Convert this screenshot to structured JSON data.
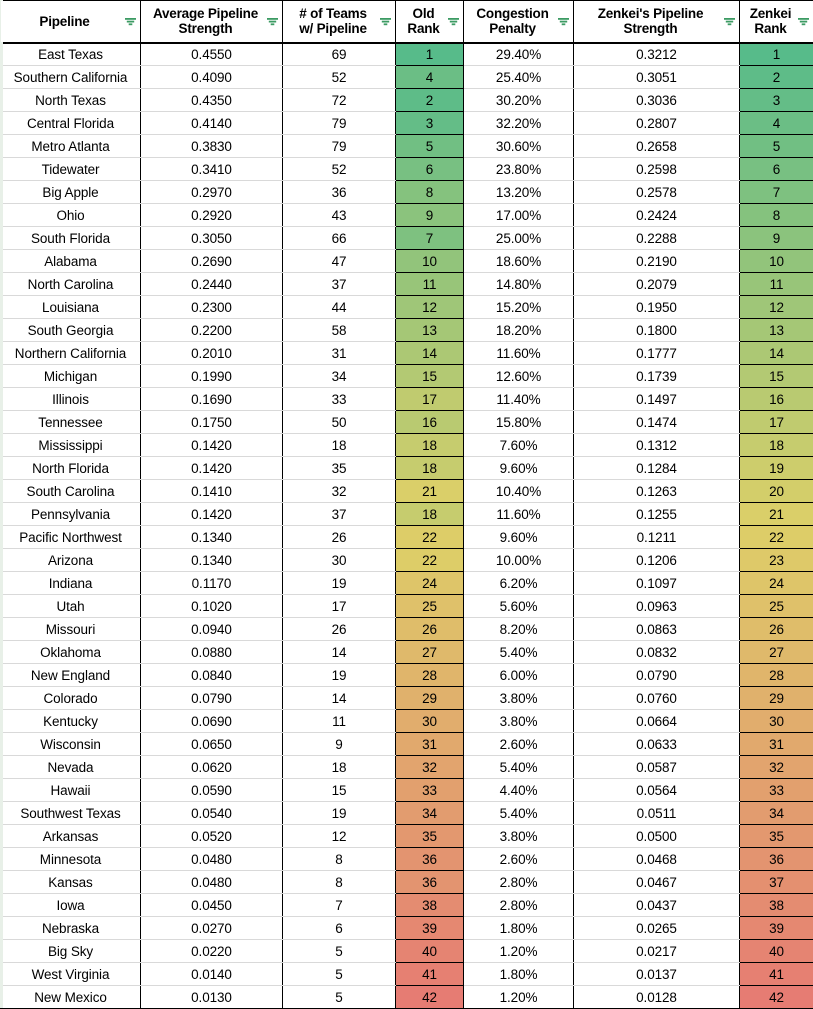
{
  "table": {
    "columns": [
      {
        "key": "pipeline",
        "label": "Pipeline",
        "filter_icon": "filter-icon"
      },
      {
        "key": "avg",
        "label": "Average Pipeline Strength",
        "filter_icon": "filter-icon"
      },
      {
        "key": "teams",
        "label": "# of Teams w/ Pipeline",
        "filter_icon": "filter-icon"
      },
      {
        "key": "old_rank",
        "label": "Old Rank",
        "filter_icon": "filter-icon"
      },
      {
        "key": "congestion",
        "label": "Congestion Penalty",
        "filter_icon": "filter-icon"
      },
      {
        "key": "zenkei_str",
        "label": "Zenkei's Pipeline Strength",
        "filter_icon": "filter-icon"
      },
      {
        "key": "zenkei_rank",
        "label": "Zenkei Rank",
        "filter_icon": "filter-icon"
      }
    ],
    "column_labels_lines": [
      [
        "Pipeline"
      ],
      [
        "Average Pipeline",
        "Strength"
      ],
      [
        "# of Teams",
        "w/ Pipeline"
      ],
      [
        "Old",
        "Rank"
      ],
      [
        "Congestion",
        "Penalty"
      ],
      [
        "Zenkei's Pipeline",
        "Strength"
      ],
      [
        "Zenkei",
        "Rank"
      ]
    ],
    "rows": [
      {
        "pipeline": "East Texas",
        "avg": "0.4550",
        "teams": "69",
        "old_rank": "1",
        "congestion": "29.40%",
        "zenkei_str": "0.3212",
        "zenkei_rank": "1"
      },
      {
        "pipeline": "Southern California",
        "avg": "0.4090",
        "teams": "52",
        "old_rank": "4",
        "congestion": "25.40%",
        "zenkei_str": "0.3051",
        "zenkei_rank": "2"
      },
      {
        "pipeline": "North Texas",
        "avg": "0.4350",
        "teams": "72",
        "old_rank": "2",
        "congestion": "30.20%",
        "zenkei_str": "0.3036",
        "zenkei_rank": "3"
      },
      {
        "pipeline": "Central Florida",
        "avg": "0.4140",
        "teams": "79",
        "old_rank": "3",
        "congestion": "32.20%",
        "zenkei_str": "0.2807",
        "zenkei_rank": "4"
      },
      {
        "pipeline": "Metro Atlanta",
        "avg": "0.3830",
        "teams": "79",
        "old_rank": "5",
        "congestion": "30.60%",
        "zenkei_str": "0.2658",
        "zenkei_rank": "5"
      },
      {
        "pipeline": "Tidewater",
        "avg": "0.3410",
        "teams": "52",
        "old_rank": "6",
        "congestion": "23.80%",
        "zenkei_str": "0.2598",
        "zenkei_rank": "6"
      },
      {
        "pipeline": "Big Apple",
        "avg": "0.2970",
        "teams": "36",
        "old_rank": "8",
        "congestion": "13.20%",
        "zenkei_str": "0.2578",
        "zenkei_rank": "7"
      },
      {
        "pipeline": "Ohio",
        "avg": "0.2920",
        "teams": "43",
        "old_rank": "9",
        "congestion": "17.00%",
        "zenkei_str": "0.2424",
        "zenkei_rank": "8"
      },
      {
        "pipeline": "South Florida",
        "avg": "0.3050",
        "teams": "66",
        "old_rank": "7",
        "congestion": "25.00%",
        "zenkei_str": "0.2288",
        "zenkei_rank": "9"
      },
      {
        "pipeline": "Alabama",
        "avg": "0.2690",
        "teams": "47",
        "old_rank": "10",
        "congestion": "18.60%",
        "zenkei_str": "0.2190",
        "zenkei_rank": "10"
      },
      {
        "pipeline": "North Carolina",
        "avg": "0.2440",
        "teams": "37",
        "old_rank": "11",
        "congestion": "14.80%",
        "zenkei_str": "0.2079",
        "zenkei_rank": "11"
      },
      {
        "pipeline": "Louisiana",
        "avg": "0.2300",
        "teams": "44",
        "old_rank": "12",
        "congestion": "15.20%",
        "zenkei_str": "0.1950",
        "zenkei_rank": "12"
      },
      {
        "pipeline": "South Georgia",
        "avg": "0.2200",
        "teams": "58",
        "old_rank": "13",
        "congestion": "18.20%",
        "zenkei_str": "0.1800",
        "zenkei_rank": "13"
      },
      {
        "pipeline": "Northern California",
        "avg": "0.2010",
        "teams": "31",
        "old_rank": "14",
        "congestion": "11.60%",
        "zenkei_str": "0.1777",
        "zenkei_rank": "14"
      },
      {
        "pipeline": "Michigan",
        "avg": "0.1990",
        "teams": "34",
        "old_rank": "15",
        "congestion": "12.60%",
        "zenkei_str": "0.1739",
        "zenkei_rank": "15"
      },
      {
        "pipeline": "Illinois",
        "avg": "0.1690",
        "teams": "33",
        "old_rank": "17",
        "congestion": "11.40%",
        "zenkei_str": "0.1497",
        "zenkei_rank": "16"
      },
      {
        "pipeline": "Tennessee",
        "avg": "0.1750",
        "teams": "50",
        "old_rank": "16",
        "congestion": "15.80%",
        "zenkei_str": "0.1474",
        "zenkei_rank": "17"
      },
      {
        "pipeline": "Mississippi",
        "avg": "0.1420",
        "teams": "18",
        "old_rank": "18",
        "congestion": "7.60%",
        "zenkei_str": "0.1312",
        "zenkei_rank": "18"
      },
      {
        "pipeline": "North Florida",
        "avg": "0.1420",
        "teams": "35",
        "old_rank": "18",
        "congestion": "9.60%",
        "zenkei_str": "0.1284",
        "zenkei_rank": "19"
      },
      {
        "pipeline": "South Carolina",
        "avg": "0.1410",
        "teams": "32",
        "old_rank": "21",
        "congestion": "10.40%",
        "zenkei_str": "0.1263",
        "zenkei_rank": "20"
      },
      {
        "pipeline": "Pennsylvania",
        "avg": "0.1420",
        "teams": "37",
        "old_rank": "18",
        "congestion": "11.60%",
        "zenkei_str": "0.1255",
        "zenkei_rank": "21"
      },
      {
        "pipeline": "Pacific Northwest",
        "avg": "0.1340",
        "teams": "26",
        "old_rank": "22",
        "congestion": "9.60%",
        "zenkei_str": "0.1211",
        "zenkei_rank": "22"
      },
      {
        "pipeline": "Arizona",
        "avg": "0.1340",
        "teams": "30",
        "old_rank": "22",
        "congestion": "10.00%",
        "zenkei_str": "0.1206",
        "zenkei_rank": "23"
      },
      {
        "pipeline": "Indiana",
        "avg": "0.1170",
        "teams": "19",
        "old_rank": "24",
        "congestion": "6.20%",
        "zenkei_str": "0.1097",
        "zenkei_rank": "24"
      },
      {
        "pipeline": "Utah",
        "avg": "0.1020",
        "teams": "17",
        "old_rank": "25",
        "congestion": "5.60%",
        "zenkei_str": "0.0963",
        "zenkei_rank": "25"
      },
      {
        "pipeline": "Missouri",
        "avg": "0.0940",
        "teams": "26",
        "old_rank": "26",
        "congestion": "8.20%",
        "zenkei_str": "0.0863",
        "zenkei_rank": "26"
      },
      {
        "pipeline": "Oklahoma",
        "avg": "0.0880",
        "teams": "14",
        "old_rank": "27",
        "congestion": "5.40%",
        "zenkei_str": "0.0832",
        "zenkei_rank": "27"
      },
      {
        "pipeline": "New England",
        "avg": "0.0840",
        "teams": "19",
        "old_rank": "28",
        "congestion": "6.00%",
        "zenkei_str": "0.0790",
        "zenkei_rank": "28"
      },
      {
        "pipeline": "Colorado",
        "avg": "0.0790",
        "teams": "14",
        "old_rank": "29",
        "congestion": "3.80%",
        "zenkei_str": "0.0760",
        "zenkei_rank": "29"
      },
      {
        "pipeline": "Kentucky",
        "avg": "0.0690",
        "teams": "11",
        "old_rank": "30",
        "congestion": "3.80%",
        "zenkei_str": "0.0664",
        "zenkei_rank": "30"
      },
      {
        "pipeline": "Wisconsin",
        "avg": "0.0650",
        "teams": "9",
        "old_rank": "31",
        "congestion": "2.60%",
        "zenkei_str": "0.0633",
        "zenkei_rank": "31"
      },
      {
        "pipeline": "Nevada",
        "avg": "0.0620",
        "teams": "18",
        "old_rank": "32",
        "congestion": "5.40%",
        "zenkei_str": "0.0587",
        "zenkei_rank": "32"
      },
      {
        "pipeline": "Hawaii",
        "avg": "0.0590",
        "teams": "15",
        "old_rank": "33",
        "congestion": "4.40%",
        "zenkei_str": "0.0564",
        "zenkei_rank": "33"
      },
      {
        "pipeline": "Southwest Texas",
        "avg": "0.0540",
        "teams": "19",
        "old_rank": "34",
        "congestion": "5.40%",
        "zenkei_str": "0.0511",
        "zenkei_rank": "34"
      },
      {
        "pipeline": "Arkansas",
        "avg": "0.0520",
        "teams": "12",
        "old_rank": "35",
        "congestion": "3.80%",
        "zenkei_str": "0.0500",
        "zenkei_rank": "35"
      },
      {
        "pipeline": "Minnesota",
        "avg": "0.0480",
        "teams": "8",
        "old_rank": "36",
        "congestion": "2.60%",
        "zenkei_str": "0.0468",
        "zenkei_rank": "36"
      },
      {
        "pipeline": "Kansas",
        "avg": "0.0480",
        "teams": "8",
        "old_rank": "36",
        "congestion": "2.80%",
        "zenkei_str": "0.0467",
        "zenkei_rank": "37"
      },
      {
        "pipeline": "Iowa",
        "avg": "0.0450",
        "teams": "7",
        "old_rank": "38",
        "congestion": "2.80%",
        "zenkei_str": "0.0437",
        "zenkei_rank": "38"
      },
      {
        "pipeline": "Nebraska",
        "avg": "0.0270",
        "teams": "6",
        "old_rank": "39",
        "congestion": "1.80%",
        "zenkei_str": "0.0265",
        "zenkei_rank": "39"
      },
      {
        "pipeline": "Big Sky",
        "avg": "0.0220",
        "teams": "5",
        "old_rank": "40",
        "congestion": "1.20%",
        "zenkei_str": "0.0217",
        "zenkei_rank": "40"
      },
      {
        "pipeline": "West Virginia",
        "avg": "0.0140",
        "teams": "5",
        "old_rank": "41",
        "congestion": "1.80%",
        "zenkei_str": "0.0137",
        "zenkei_rank": "41"
      },
      {
        "pipeline": "New Mexico",
        "avg": "0.0130",
        "teams": "5",
        "old_rank": "42",
        "congestion": "1.20%",
        "zenkei_str": "0.0128",
        "zenkei_rank": "42"
      }
    ]
  },
  "colors": {
    "scale_min": "#57bb8a",
    "scale_mid": "#ddcf68",
    "scale_max": "#e67c73",
    "filter_icon": "#3c9b63",
    "grid_line": "#d9d9d9",
    "border": "#000000"
  },
  "conditional_format": {
    "rank_min": 1,
    "rank_mid": 21.5,
    "rank_max": 42
  }
}
